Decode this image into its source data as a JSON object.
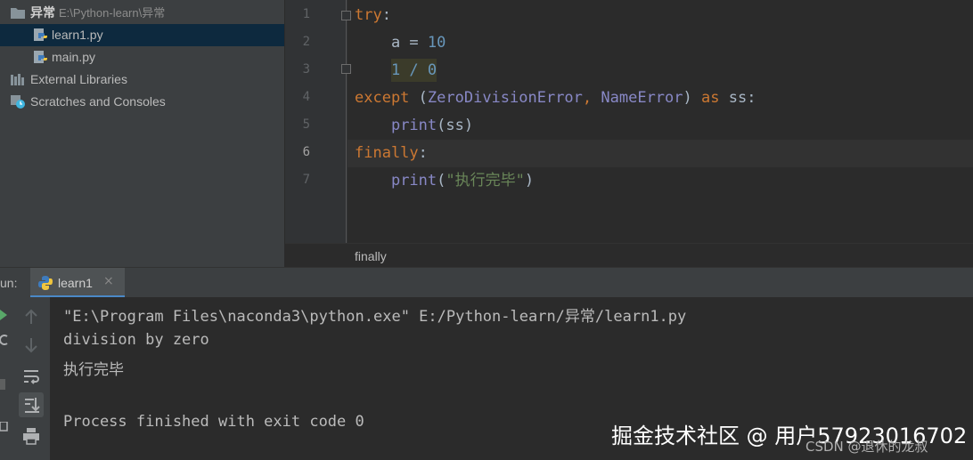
{
  "project_tree": {
    "items": [
      {
        "label": "异常",
        "path": "E:\\Python-learn\\异常",
        "icon": "folder-icon"
      },
      {
        "label": "learn1.py",
        "icon": "python-file-icon",
        "selected": true
      },
      {
        "label": "main.py",
        "icon": "python-file-icon"
      },
      {
        "label": "External Libraries",
        "icon": "libraries-icon"
      },
      {
        "label": "Scratches and Consoles",
        "icon": "scratches-icon"
      }
    ]
  },
  "editor": {
    "line_numbers": [
      "1",
      "2",
      "3",
      "4",
      "5",
      "6",
      "7"
    ],
    "active_line": "6",
    "code": {
      "l1_kw": "try",
      "l1_colon": ":",
      "l2_var": "    a = ",
      "l2_num": "10",
      "l3_indent": "    ",
      "l3_expr": "1 / 0",
      "l4_kw": "except",
      "l4_open": " (",
      "l4_cls1": "ZeroDivisionError",
      "l4_comma": ", ",
      "l4_cls2": "NameError",
      "l4_close": ") ",
      "l4_as": "as",
      "l4_rest": " ss:",
      "l5_indent": "    ",
      "l5_func": "print",
      "l5_rest": "(ss)",
      "l6_kw": "finally",
      "l6_colon": ":",
      "l7_indent": "    ",
      "l7_func": "print",
      "l7_open": "(",
      "l7_str": "\"执行完毕\"",
      "l7_close": ")"
    },
    "breadcrumb": "finally"
  },
  "run_panel": {
    "label": "un:",
    "tab_label": "learn1",
    "tab_close": "×",
    "output": [
      "\"E:\\Program Files\\naconda3\\python.exe\" E:/Python-learn/异常/learn1.py",
      "division by zero",
      "执行完毕",
      "",
      "Process finished with exit code 0"
    ],
    "tools": [
      "up-arrow-icon",
      "down-arrow-icon",
      "soft-wrap-icon",
      "scroll-to-end-icon",
      "print-icon"
    ]
  },
  "watermarks": {
    "juejin": "掘金技术社区 @ 用户57923016702",
    "csdn": "CSDN @退休的龙叔"
  },
  "colors": {
    "keyword": "#cc7832",
    "number": "#6897bb",
    "builtin_class": "#8888c6",
    "string": "#6a8759",
    "selection": "#0d293e",
    "tab_underline": "#4a88c7"
  }
}
